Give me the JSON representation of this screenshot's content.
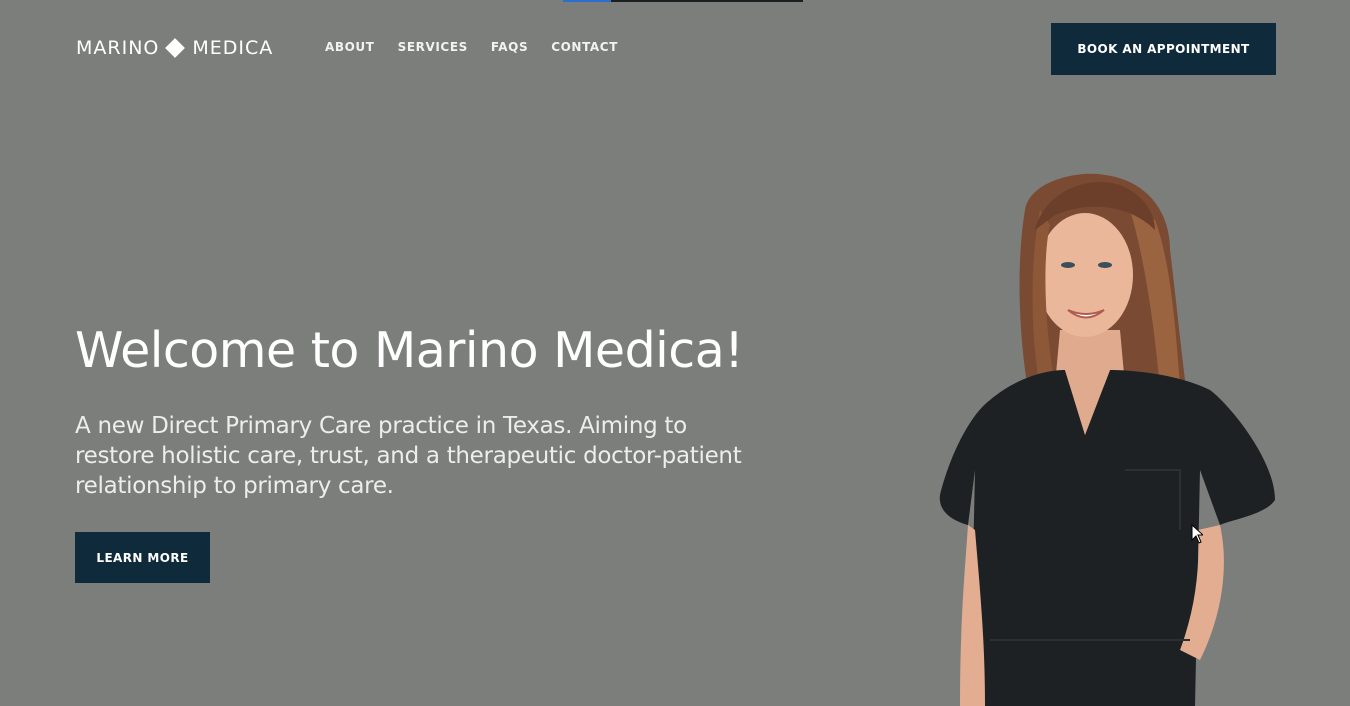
{
  "brand": {
    "name_left": "MARINO",
    "name_right": "MEDICA",
    "logo_icon": "diamond-icon"
  },
  "nav": {
    "items": [
      {
        "label": "ABOUT"
      },
      {
        "label": "SERVICES"
      },
      {
        "label": "FAQS"
      },
      {
        "label": "CONTACT"
      }
    ]
  },
  "header": {
    "cta_label": "BOOK AN APPOINTMENT"
  },
  "hero": {
    "title": "Welcome to Marino Medica!",
    "subtitle": "A new Direct Primary Care practice in Texas. Aiming to restore holistic care, trust, and a therapeutic doctor-patient relationship to primary care.",
    "cta_label": "LEARN MORE",
    "image_subject": "smiling doctor in navy scrubs"
  },
  "top_progress": {
    "fraction": 0.2
  },
  "colors": {
    "background": "#7b7e7b",
    "button": "#0f2a3a",
    "text": "#ffffff",
    "progress": "#2c6fd1"
  }
}
